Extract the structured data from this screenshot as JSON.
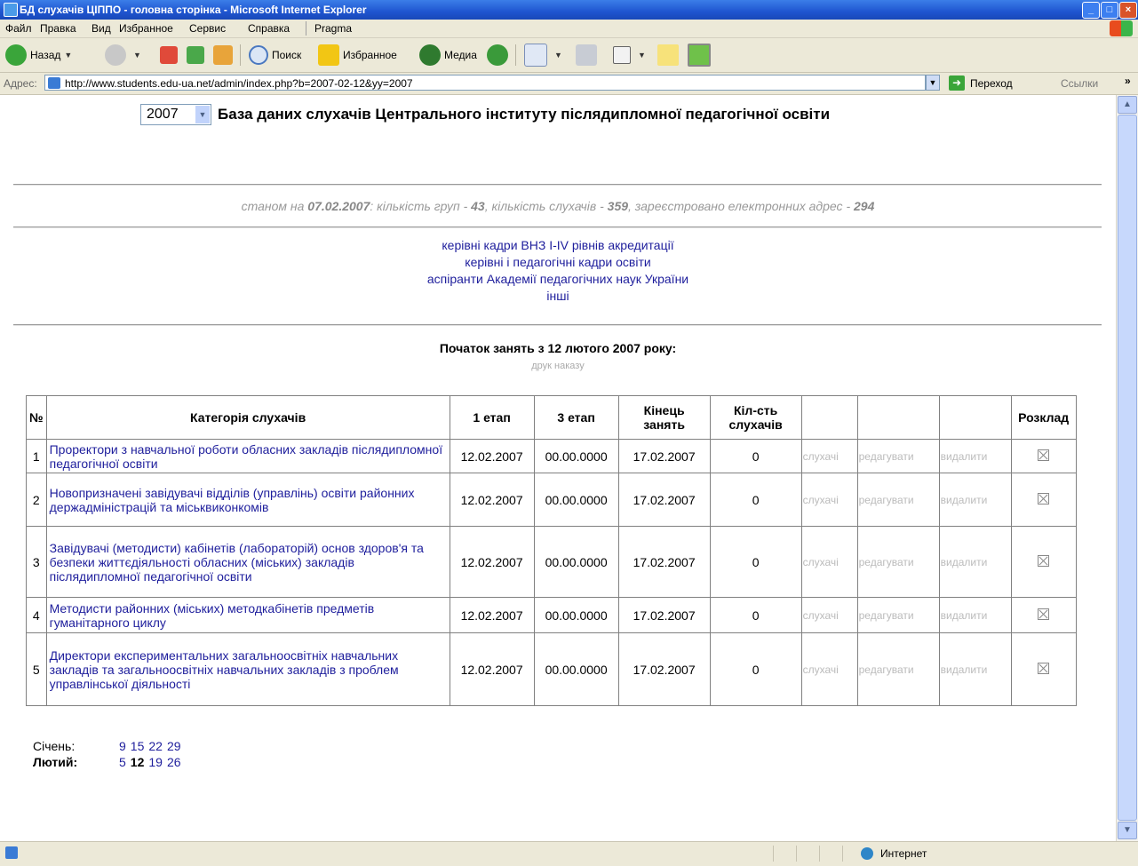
{
  "window": {
    "title": "БД слухачів ЦІППО - головна сторінка - Microsoft Internet Explorer",
    "minimize": "_",
    "maximize": "□",
    "close": "×"
  },
  "menu": [
    "Файл",
    "Правка",
    "Вид",
    "Избранное",
    "Сервис",
    "Справка",
    "Pragma"
  ],
  "toolbar": {
    "back": "Назад",
    "search": "Поиск",
    "favorites": "Избранное",
    "media": "Медиа"
  },
  "address": {
    "label": "Адрес:",
    "url": "http://www.students.edu-ua.net/admin/index.php?b=2007-02-12&yy=2007",
    "go": "Переход",
    "links": "Ссылки"
  },
  "page": {
    "year": "2007",
    "title": "База даних слухачів Центрального інституту післядипломної педагогічної освіти",
    "stats": {
      "prefix": "станом на ",
      "date": "07.02.2007",
      "groups_label": ": кількість груп - ",
      "groups": "43",
      "students_label": ", кількість слухачів - ",
      "students": "359",
      "emails_label": ", зареєстровано електронних адрес - ",
      "emails": "294"
    },
    "categories": [
      "керівні кадри ВНЗ I-IV рівнів акредитації",
      "керівні і педагогічні кадри освіти",
      "аспіранти Академії педагогічних наук України",
      "інші"
    ],
    "start_line": "Початок занять з 12 лютого 2007 року:",
    "print_order": "друк наказу",
    "table": {
      "headers": {
        "num": "№",
        "category": "Категорія слухачів",
        "stage1": "1 етап",
        "stage3": "3 етап",
        "end": "Кінець занять",
        "count": "Кіл-сть слухачів",
        "schedule": "Розклад"
      },
      "rows": [
        {
          "num": "1",
          "name": "Проректори з навчальної роботи обласних закладів післядипломної педагогічної освіти",
          "stage1": "12.02.2007",
          "stage3": "00.00.0000",
          "end": "17.02.2007",
          "count": "0",
          "a1": "слухачі",
          "a2": "редагувати",
          "a3": "видалити"
        },
        {
          "num": "2",
          "name": "Новопризначені завідувачі відділів (управлінь) освіти районних держадміністрацій та міськвиконкомів",
          "stage1": "12.02.2007",
          "stage3": "00.00.0000",
          "end": "17.02.2007",
          "count": "0",
          "a1": "слухачі",
          "a2": "редагувати",
          "a3": "видалити"
        },
        {
          "num": "3",
          "name": "Завідувачі (методисти) кабінетів (лабораторій) основ здоров'я та безпеки життєдіяльності обласних (міських) закладів післядипломної педагогічної освіти",
          "stage1": "12.02.2007",
          "stage3": "00.00.0000",
          "end": "17.02.2007",
          "count": "0",
          "a1": "слухачі",
          "a2": "редагувати",
          "a3": "видалити"
        },
        {
          "num": "4",
          "name": "Методисти районних (міських) методкабінетів предметів гуманітарного циклу",
          "stage1": "12.02.2007",
          "stage3": "00.00.0000",
          "end": "17.02.2007",
          "count": "0",
          "a1": "слухачі",
          "a2": "редагувати",
          "a3": "видалити"
        },
        {
          "num": "5",
          "name": "Директори експериментальних загальноосвітніх навчальних закладів та загальноосвітніх навчальних закладів з проблем управлінської діяльності",
          "stage1": "12.02.2007",
          "stage3": "00.00.0000",
          "end": "17.02.2007",
          "count": "0",
          "a1": "слухачі",
          "a2": "редагувати",
          "a3": "видалити"
        }
      ]
    },
    "months": [
      {
        "label": "Січень:",
        "bold": false,
        "days": [
          "9",
          "15",
          "22",
          "29"
        ],
        "current": null
      },
      {
        "label": "Лютий:",
        "bold": true,
        "days": [
          "5",
          "12",
          "19",
          "26"
        ],
        "current": "12"
      }
    ]
  },
  "status": {
    "zone": "Интернет"
  }
}
